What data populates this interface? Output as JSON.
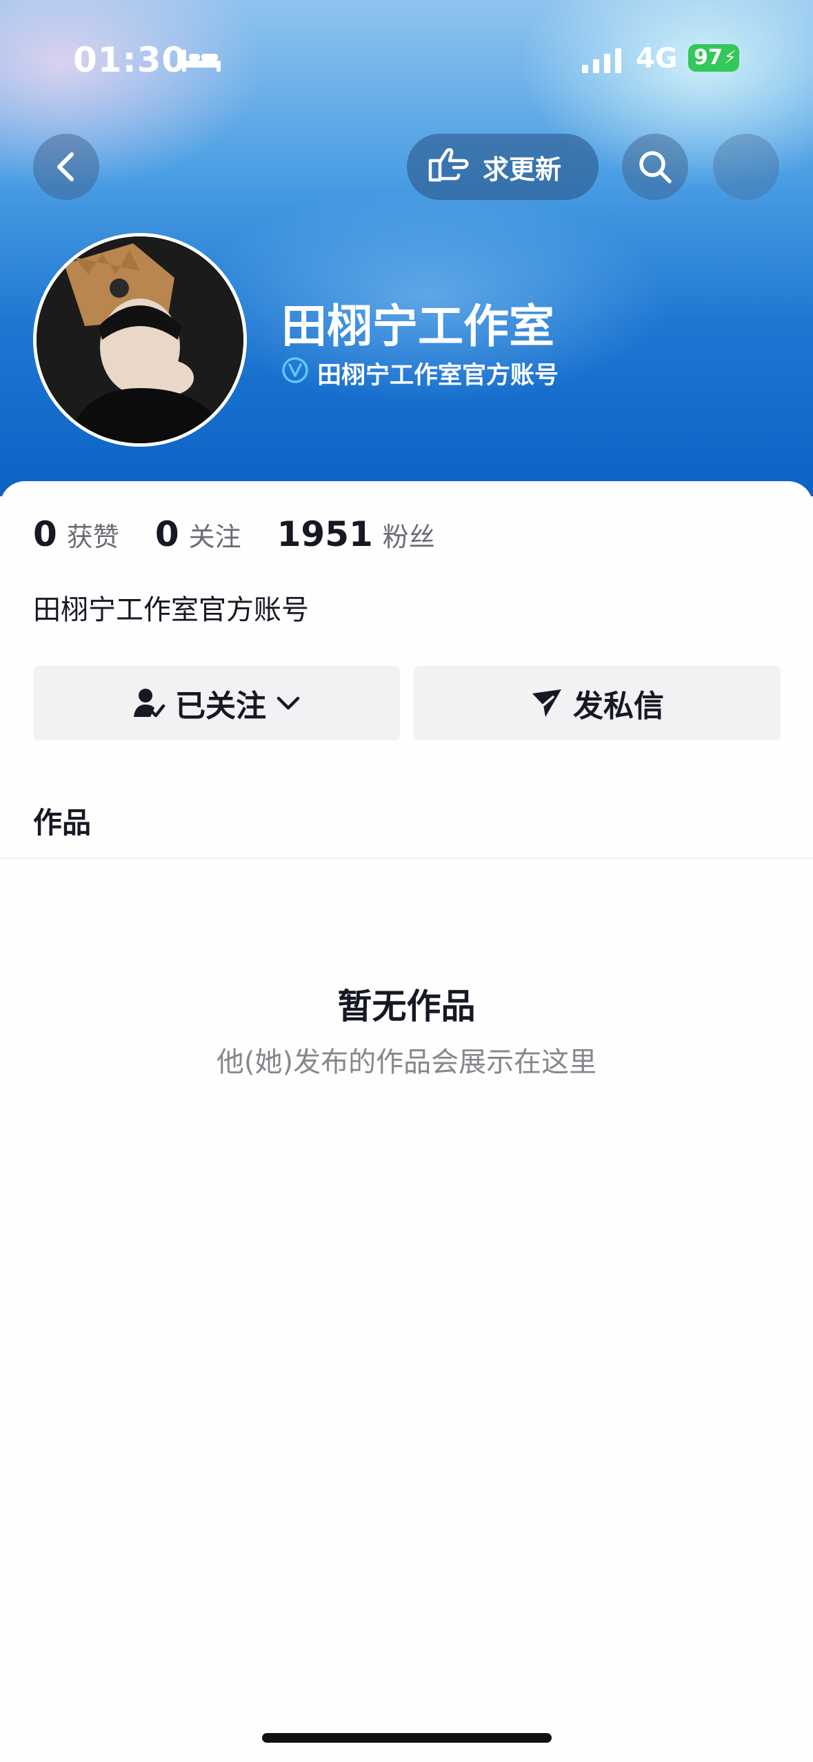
{
  "status_bar": {
    "time": "01:30",
    "network": "4G",
    "battery": "97"
  },
  "header": {
    "update_label": "求更新",
    "profile_name": "田栩宁工作室",
    "verified_label": "田栩宁工作室官方账号"
  },
  "stats": [
    {
      "value": "0",
      "label": "获赞"
    },
    {
      "value": "0",
      "label": "关注"
    },
    {
      "value": "1951",
      "label": "粉丝"
    }
  ],
  "bio": "田栩宁工作室官方账号",
  "actions": {
    "follow_label": "已关注",
    "message_label": "发私信"
  },
  "tabs": {
    "works_label": "作品"
  },
  "empty_state": {
    "title": "暂无作品",
    "subtitle": "他(她)发布的作品会展示在这里"
  },
  "colors": {
    "battery": "#34c759",
    "verify_icon": "#5ec8ff",
    "banner": "#1f77d2"
  }
}
